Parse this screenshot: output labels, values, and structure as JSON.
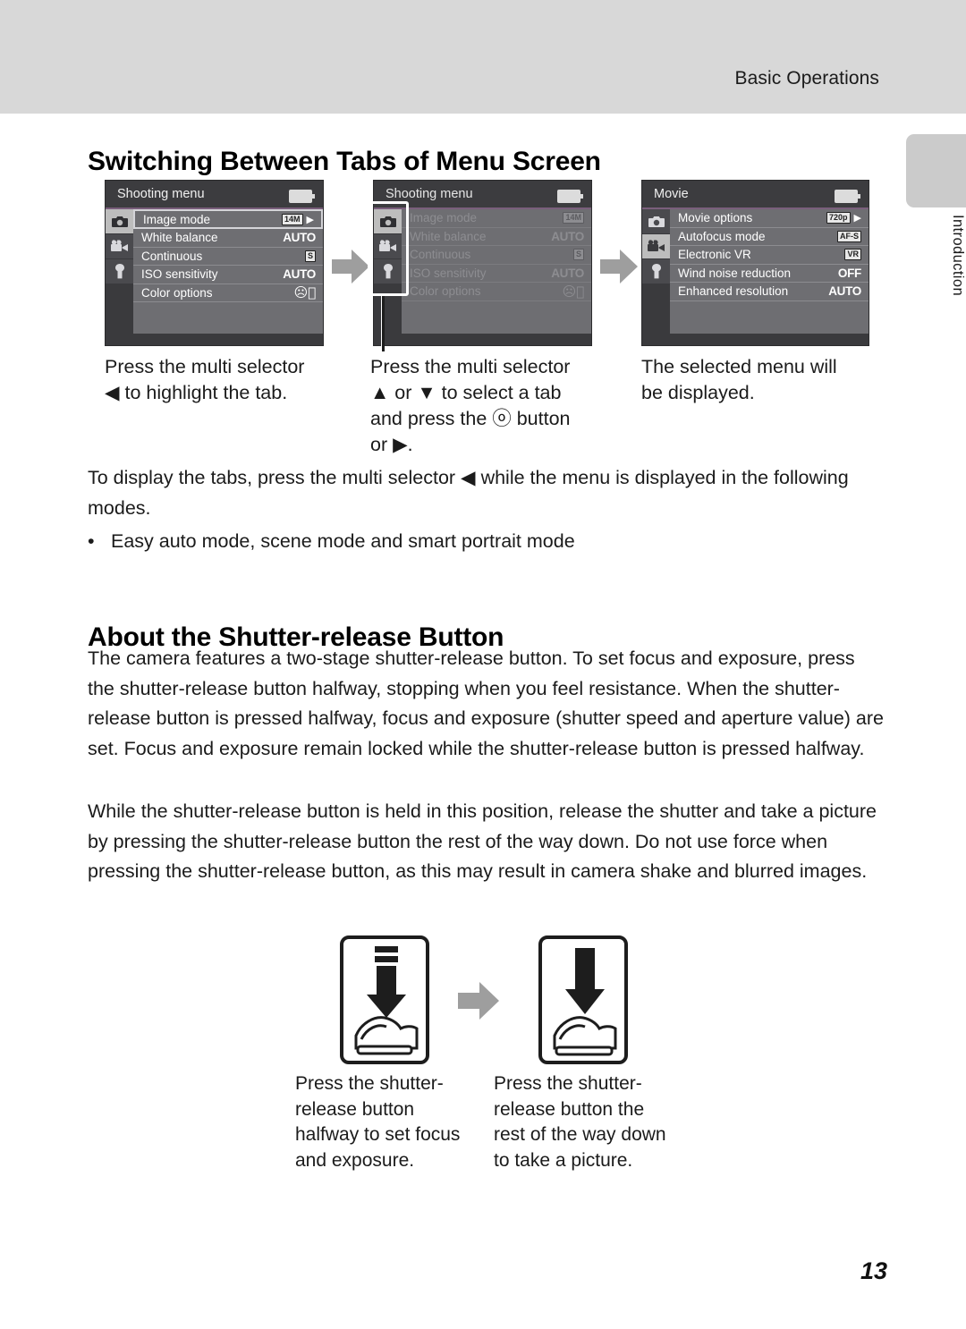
{
  "page": {
    "running_head": "Basic Operations",
    "page_number": "13",
    "thumb_tab_label": "Introduction"
  },
  "sections": [
    {
      "heading": "Switching Between Tabs of Menu Screen",
      "paragraphs": [
        "To display the tabs, press the multi selector ◀ while the menu is displayed in the following modes."
      ],
      "bullets": [
        "Easy auto mode, scene mode and smart portrait mode"
      ]
    },
    {
      "heading": "About the Shutter-release Button",
      "paragraphs": [
        "The camera features a two-stage shutter-release button. To set focus and exposure, press the shutter-release button halfway, stopping when you feel resistance. When the shutter-release button is pressed halfway, focus and exposure (shutter speed and aperture value) are set. Focus and exposure remain locked while the shutter-release button is pressed halfway.",
        "While the shutter-release button is held in this position, release the shutter and take a picture by pressing the shutter-release button the rest of the way down. Do not use force when pressing the shutter-release button, as this may result in camera shake and blurred images."
      ]
    }
  ],
  "menu_figures": {
    "screens": [
      {
        "title": "Shooting menu",
        "active_tab": "shooting",
        "dimmed": false,
        "selected_row": 0,
        "rows": [
          {
            "label": "Image mode",
            "value": "14M",
            "value_kind": "badge",
            "has_caret": true
          },
          {
            "label": "White balance",
            "value": "AUTO",
            "value_kind": "text",
            "has_caret": false
          },
          {
            "label": "Continuous",
            "value": "S",
            "value_kind": "badge",
            "has_caret": false
          },
          {
            "label": "ISO sensitivity",
            "value": "AUTO",
            "value_kind": "text",
            "has_caret": false
          },
          {
            "label": "Color options",
            "value": "OFF-glyph",
            "value_kind": "glyph",
            "has_caret": false
          }
        ]
      },
      {
        "title": "Shooting menu",
        "active_tab": "shooting",
        "dimmed": true,
        "selected_row": -1,
        "rows": [
          {
            "label": "Image mode",
            "value": "14M",
            "value_kind": "badge",
            "has_caret": false
          },
          {
            "label": "White balance",
            "value": "AUTO",
            "value_kind": "text",
            "has_caret": false
          },
          {
            "label": "Continuous",
            "value": "S",
            "value_kind": "badge",
            "has_caret": false
          },
          {
            "label": "ISO sensitivity",
            "value": "AUTO",
            "value_kind": "text",
            "has_caret": false
          },
          {
            "label": "Color options",
            "value": "OFF-glyph",
            "value_kind": "glyph",
            "has_caret": false
          }
        ]
      },
      {
        "title": "Movie",
        "active_tab": "movie",
        "dimmed": false,
        "selected_row": -1,
        "rows": [
          {
            "label": "Movie options",
            "value": "720p",
            "value_kind": "badge",
            "has_caret": true
          },
          {
            "label": "Autofocus mode",
            "value": "AF-S",
            "value_kind": "badge",
            "has_caret": false
          },
          {
            "label": "Electronic VR",
            "value": "VR",
            "value_kind": "badge",
            "has_caret": false
          },
          {
            "label": "Wind noise reduction",
            "value": "OFF",
            "value_kind": "text",
            "has_caret": false
          },
          {
            "label": "Enhanced resolution",
            "value": "AUTO",
            "value_kind": "text",
            "has_caret": false
          }
        ]
      }
    ],
    "tab_icon_names": [
      "camera-icon",
      "movie-camera-icon",
      "wrench-icon"
    ],
    "captions": [
      "Press the multi selector ◀ to highlight the tab.",
      "Press the multi selector ▲ or ▼ to select a tab and press the Ⓚ button or ▶.",
      "The selected menu will be displayed."
    ],
    "caption_lines": [
      [
        "Press the multi selector",
        "◀ to highlight the tab."
      ],
      [
        "Press the multi selector",
        "▲ or ▼ to select a tab",
        "and press the ⓞ button",
        "or ▶."
      ],
      [
        "The selected menu will",
        "be displayed."
      ]
    ]
  },
  "shutter_figures": {
    "items": [
      {
        "icon": "shutter-halfway-icon",
        "caption_lines": [
          "Press the shutter-",
          "release button",
          "halfway to set focus",
          "and exposure."
        ]
      },
      {
        "icon": "shutter-fulldown-icon",
        "caption_lines": [
          "Press the shutter-",
          "release button the",
          "rest of the way down",
          "to take a picture."
        ]
      }
    ]
  },
  "colors": {
    "header_band": "#d8d8d8",
    "thumb_tab": "#cbcbcb",
    "screen_body": "#6e6e72",
    "screen_chrome": "#3a3a3d",
    "accent_underline": "#7a5f7c",
    "arrow_grey": "#9e9e9e"
  }
}
